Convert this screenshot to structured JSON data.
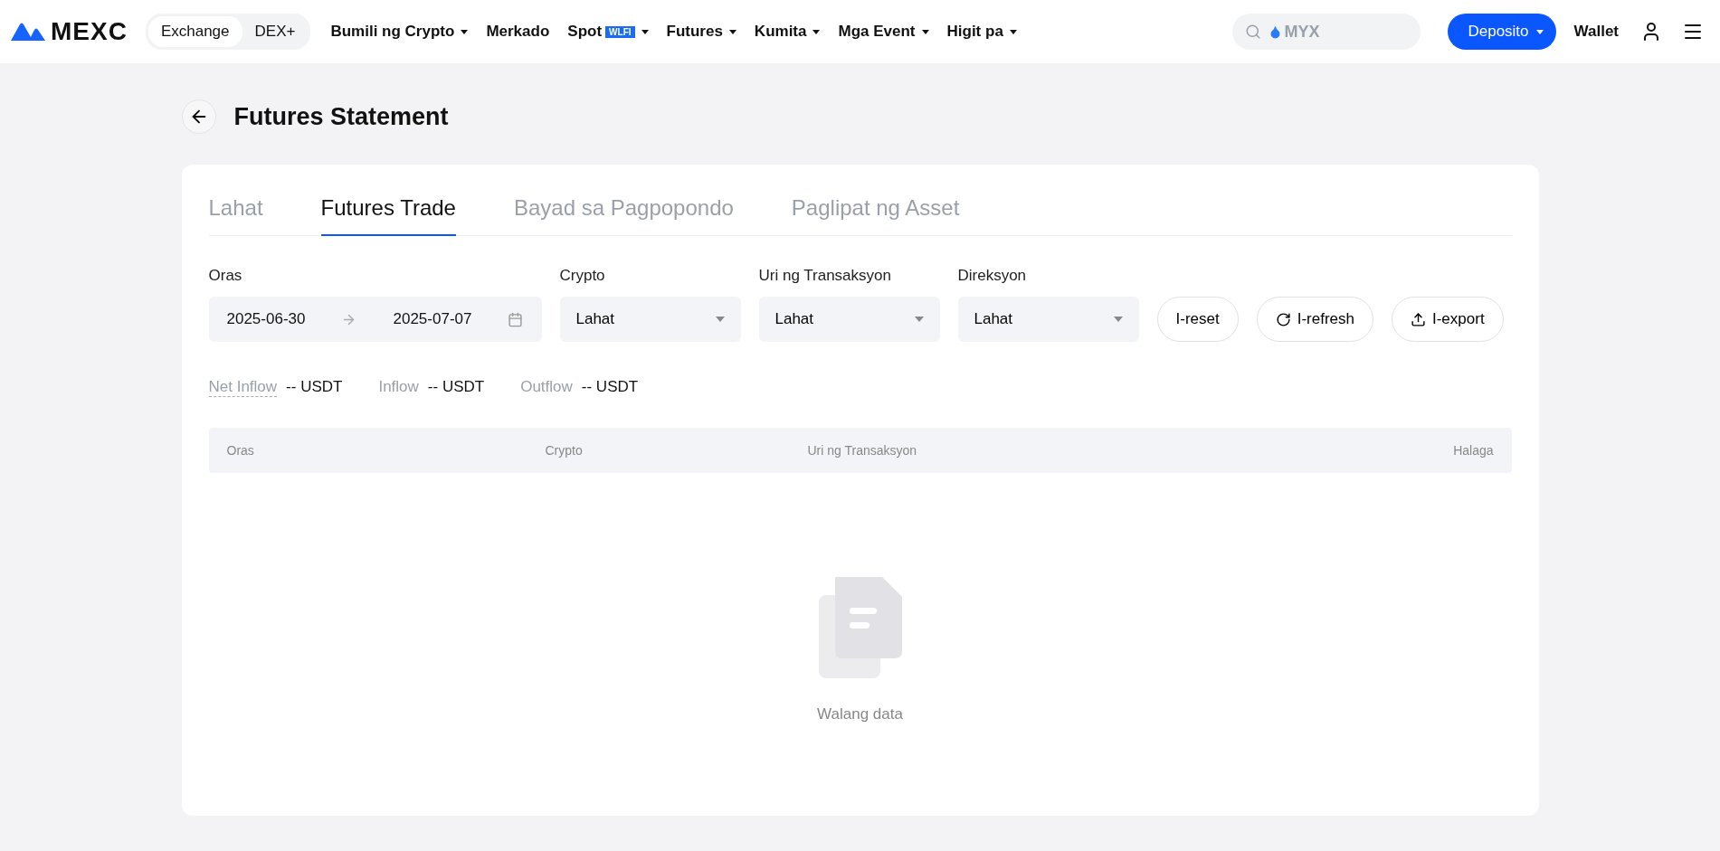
{
  "nav": {
    "logo": "MEXC",
    "switch": [
      {
        "label": "Exchange",
        "selected": true
      },
      {
        "label": "DEX+",
        "selected": false
      }
    ],
    "menu": [
      {
        "label": "Bumili ng Crypto",
        "dropdown": true
      },
      {
        "label": "Merkado",
        "dropdown": false
      },
      {
        "label": "Spot",
        "badge": "WLFI",
        "dropdown": true
      },
      {
        "label": "Futures",
        "dropdown": true
      },
      {
        "label": "Kumita",
        "dropdown": true
      },
      {
        "label": "Mga Event",
        "dropdown": true
      },
      {
        "label": "Higit pa",
        "dropdown": true
      }
    ],
    "search": {
      "placeholder": "MYX"
    },
    "deposit": "Deposito",
    "wallet": "Wallet"
  },
  "page": {
    "title": "Futures Statement"
  },
  "tabs": [
    {
      "label": "Lahat",
      "selected": false
    },
    {
      "label": "Futures Trade",
      "selected": true
    },
    {
      "label": "Bayad sa Pagpopondo",
      "selected": false
    },
    {
      "label": "Paglipat ng Asset",
      "selected": false
    }
  ],
  "filters": {
    "time": {
      "label": "Oras",
      "start": "2025-06-30",
      "end": "2025-07-07"
    },
    "selects": [
      {
        "label": "Crypto",
        "value": "Lahat"
      },
      {
        "label": "Uri ng Transaksyon",
        "value": "Lahat"
      },
      {
        "label": "Direksyon",
        "value": "Lahat"
      }
    ],
    "buttons": [
      {
        "kind": "plain",
        "label": "I-reset"
      },
      {
        "kind": "refresh",
        "label": "I-refresh"
      },
      {
        "kind": "export",
        "label": "I-export"
      }
    ]
  },
  "summary": [
    {
      "label": "Net Inflow",
      "value": "-- USDT",
      "dotted": true
    },
    {
      "label": "Inflow",
      "value": "-- USDT",
      "dotted": false
    },
    {
      "label": "Outflow",
      "value": "-- USDT",
      "dotted": false
    }
  ],
  "table": {
    "columns": [
      "Oras",
      "Crypto",
      "Uri ng Transaksyon",
      "Halaga"
    ],
    "empty": "Walang data"
  }
}
